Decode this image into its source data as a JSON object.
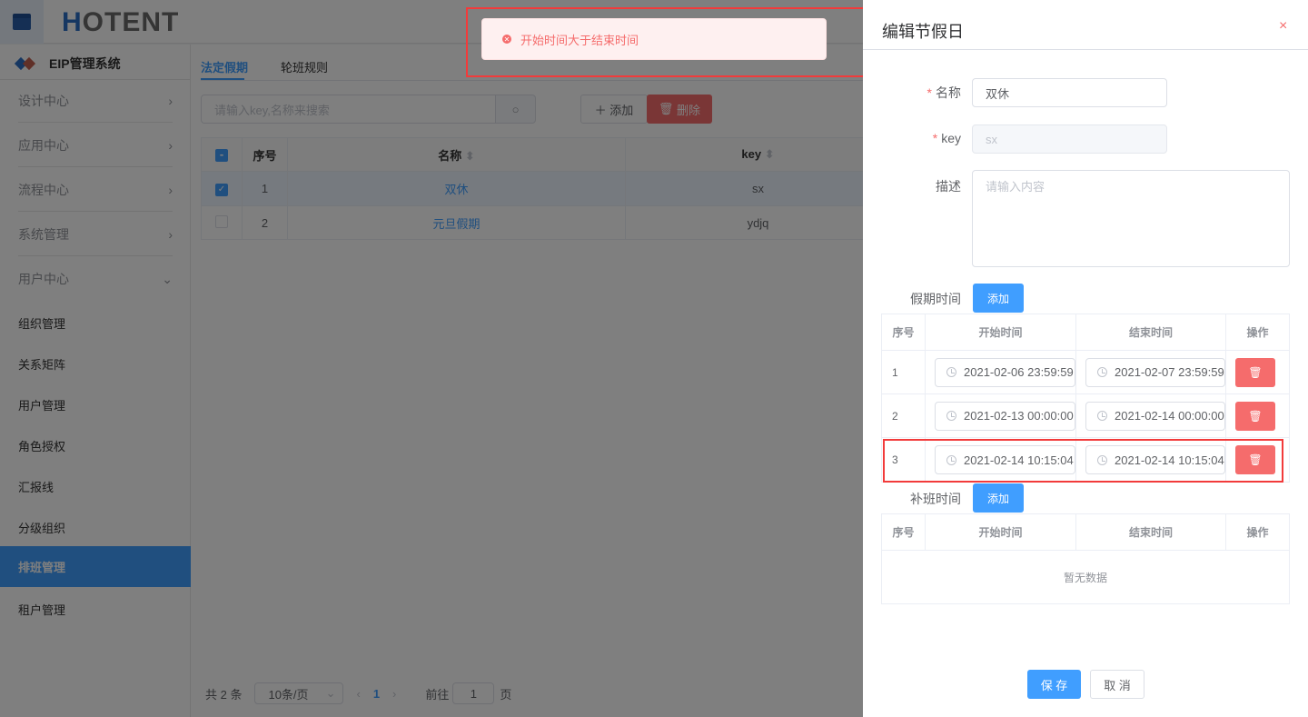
{
  "header": {
    "logo_text": "HOTENT",
    "menu_icon": "menu-icon"
  },
  "sidebar": {
    "brand": "EIP管理系统",
    "groups": [
      {
        "label": "设计中心"
      },
      {
        "label": "应用中心"
      },
      {
        "label": "流程中心"
      },
      {
        "label": "系统管理"
      },
      {
        "label": "用户中心"
      }
    ],
    "sub_items": [
      {
        "label": "组织管理"
      },
      {
        "label": "关系矩阵"
      },
      {
        "label": "用户管理"
      },
      {
        "label": "角色授权"
      },
      {
        "label": "汇报线"
      },
      {
        "label": "分级组织"
      },
      {
        "label": "排班管理",
        "active": true
      },
      {
        "label": "租户管理"
      }
    ]
  },
  "main": {
    "tabs": [
      {
        "label": "法定假期",
        "active": true
      },
      {
        "label": "轮班规则"
      }
    ],
    "search_placeholder": "请输入key,名称来搜索",
    "add_label": "添加",
    "delete_label": "删除",
    "columns": [
      "序号",
      "名称",
      "key"
    ],
    "rows": [
      {
        "index": "1",
        "name": "双休",
        "key": "sx",
        "checked": true
      },
      {
        "index": "2",
        "name": "元旦假期",
        "key": "ydjq",
        "checked": false
      }
    ],
    "pagination": {
      "total": "共 2 条",
      "page_size": "10条/页",
      "current": "1",
      "goto_label": "前往",
      "goto_value": "1",
      "page_suffix": "页"
    }
  },
  "toast": {
    "message": "开始时间大于结束时间",
    "type": "error"
  },
  "drawer": {
    "title": "编辑节假日",
    "close": "×",
    "name_label": "名称",
    "name_value": "双休",
    "key_label": "key",
    "key_value": "sx",
    "desc_label": "描述",
    "desc_placeholder": "请输入内容",
    "holiday_label": "假期时间",
    "add_label": "添加",
    "columns": [
      "序号",
      "开始时间",
      "结束时间",
      "操作"
    ],
    "holiday_rows": [
      {
        "index": "1",
        "start": "2021-02-06 23:59:59",
        "end": "2021-02-07 23:59:59"
      },
      {
        "index": "2",
        "start": "2021-02-13 00:00:00",
        "end": "2021-02-14 00:00:00"
      },
      {
        "index": "3",
        "start": "2021-02-14 10:15:04",
        "end": "2021-02-14 10:15:04"
      }
    ],
    "workday_label": "补班时间",
    "empty_text": "暂无数据",
    "save_label": "保 存",
    "cancel_label": "取 消"
  }
}
